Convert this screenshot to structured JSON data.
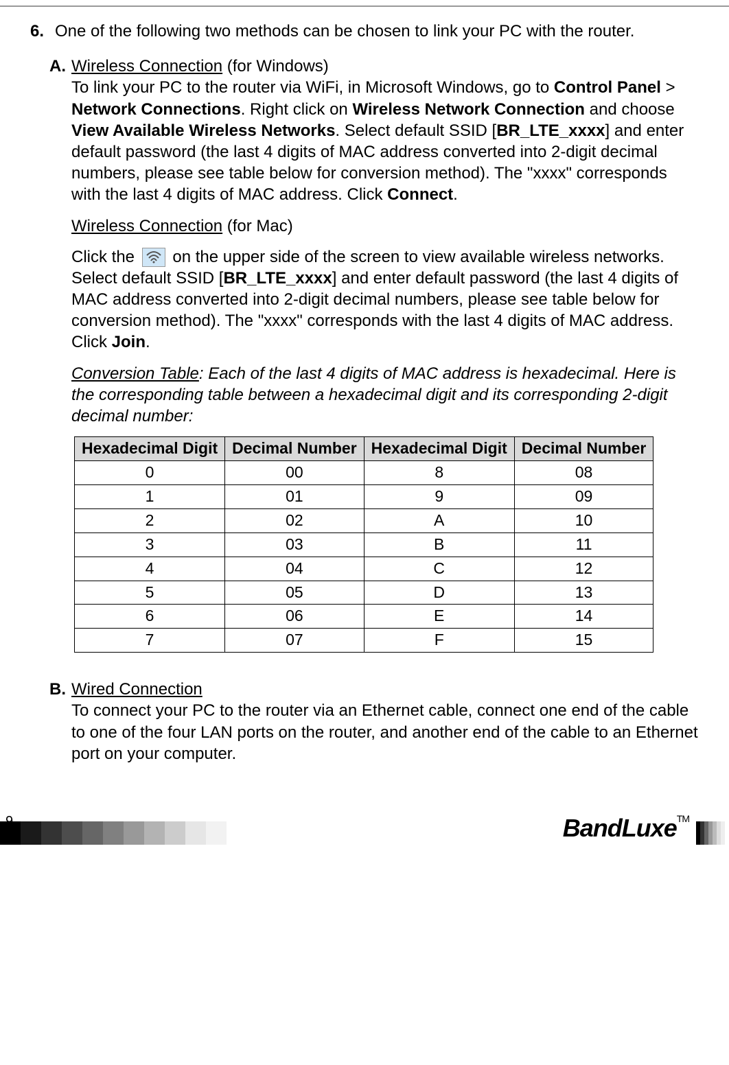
{
  "step": {
    "number": "6.",
    "intro": "One of the following two methods can be chosen to link your PC with the router."
  },
  "sectionA": {
    "letter": "A.",
    "title_win": "Wireless Connection",
    "title_win_suffix": " (for Windows)",
    "win_p1a": "To link your PC to the router via WiFi, in Microsoft Windows, go to ",
    "win_cp": "Control Panel",
    "gt": " > ",
    "win_nc": "Network Connections",
    "win_p1b": ". Right click on ",
    "win_wnc": "Wireless Network Connection",
    "win_p1c": " and choose ",
    "win_vawn": "View Available Wireless Networks",
    "win_p1d": ". Select default SSID [",
    "ssid": "BR_LTE_xxxx",
    "win_p1e": "] and enter default password (the last 4 digits of MAC address converted into 2-digit decimal numbers, please see table below for conversion method). The \"xxxx\" corresponds with the last 4 digits of MAC address. Click ",
    "connect": "Connect",
    "dot": ".",
    "title_mac": "Wireless Connection",
    "title_mac_suffix": " (for Mac)",
    "mac_p1a": "Click the ",
    "mac_p1b": " on the upper side of the screen to view available wireless networks. Select default SSID [",
    "mac_p1c": "] and enter default password (the last 4 digits of MAC address converted into 2-digit decimal numbers, please see table below for conversion method). The \"xxxx\" corresponds with the last 4 digits of MAC address. Click ",
    "join": "Join",
    "conv_title": "Conversion Table",
    "conv_desc": ": Each of the last 4 digits of MAC address is hexadecimal. Here is the corresponding table between a hexadecimal digit and its corresponding 2-digit decimal number:"
  },
  "table": {
    "h1": "Hexadecimal Digit",
    "h2": "Decimal Number",
    "h3": "Hexadecimal Digit",
    "h4": "Decimal Number",
    "rows": [
      {
        "a": "0",
        "b": "00",
        "c": "8",
        "d": "08"
      },
      {
        "a": "1",
        "b": "01",
        "c": "9",
        "d": "09"
      },
      {
        "a": "2",
        "b": "02",
        "c": "A",
        "d": "10"
      },
      {
        "a": "3",
        "b": "03",
        "c": "B",
        "d": "11"
      },
      {
        "a": "4",
        "b": "04",
        "c": "C",
        "d": "12"
      },
      {
        "a": "5",
        "b": "05",
        "c": "D",
        "d": "13"
      },
      {
        "a": "6",
        "b": "06",
        "c": "E",
        "d": "14"
      },
      {
        "a": "7",
        "b": "07",
        "c": "F",
        "d": "15"
      }
    ]
  },
  "sectionB": {
    "letter": "B.",
    "title": "Wired Connection",
    "body": "To connect your PC to the router via an Ethernet cable, connect one end of the cable to one of the four LAN ports on the router, and another end of the cable to an Ethernet port on your computer."
  },
  "footer": {
    "page": "9",
    "brand": "BandLuxe",
    "tm": "TM"
  },
  "grad_colors": [
    "#000000",
    "#1a1a1a",
    "#333333",
    "#4d4d4d",
    "#666666",
    "#808080",
    "#999999",
    "#b3b3b3",
    "#cccccc",
    "#e6e6e6",
    "#f2f2f2",
    "#ffffff"
  ],
  "stripe_colors": [
    "#000",
    "#333",
    "#666",
    "#999",
    "#bbb",
    "#ddd",
    "#eee",
    "#fff"
  ]
}
